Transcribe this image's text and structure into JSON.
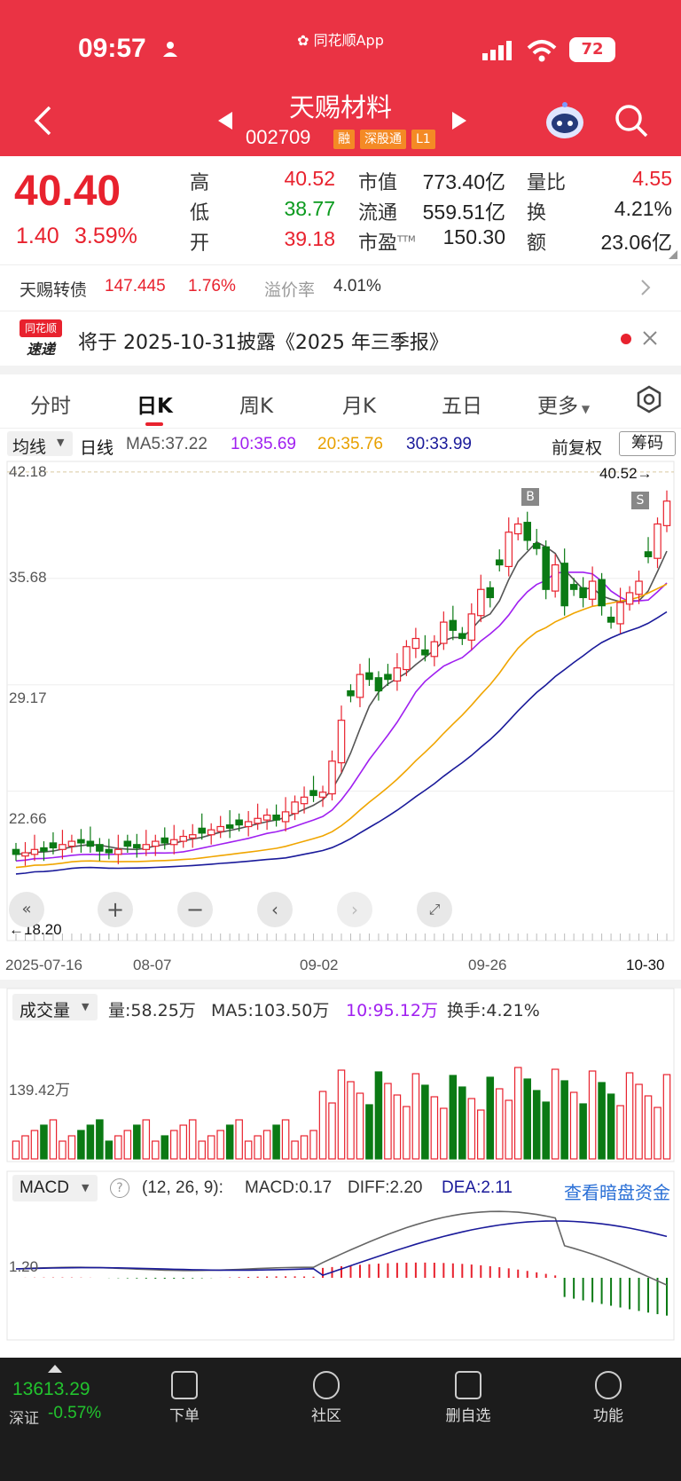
{
  "status_bar": {
    "time": "09:57",
    "app_name": "同花顺App",
    "battery": "72"
  },
  "header": {
    "title": "天赐材料",
    "code": "002709",
    "tags": [
      "融",
      "深股通",
      "L1"
    ]
  },
  "quote": {
    "price": "40.40",
    "change": "1.40",
    "change_pct": "3.59%",
    "high_label": "高",
    "high": "40.52",
    "low_label": "低",
    "low": "38.77",
    "open_label": "开",
    "open": "39.18",
    "mcap_label": "市值",
    "mcap": "773.40亿",
    "float_label": "流通",
    "float": "559.51亿",
    "pe_label": "市盈",
    "pe_sup": "TTM",
    "pe": "150.30",
    "vr_label": "量比",
    "vr": "4.55",
    "turnover_label": "换",
    "turnover": "4.21%",
    "amount_label": "额",
    "amount": "23.06亿"
  },
  "bond": {
    "name": "天赐转债",
    "price": "147.445",
    "pct": "1.76%",
    "premium_label": "溢价率",
    "premium": "4.01%"
  },
  "notice": {
    "logo_top": "同花顺",
    "logo_bottom": "速递",
    "text": "将于 2025-10-31披露《2025 年三季报》"
  },
  "tabs": [
    "分时",
    "日K",
    "周K",
    "月K",
    "五日",
    "更多"
  ],
  "kline": {
    "indicator": "均线",
    "period": "日线",
    "ma5": "MA5:37.22",
    "ma10": "10:35.69",
    "ma20": "20:35.76",
    "ma30": "30:33.99",
    "adjust": "前复权",
    "chip": "筹码",
    "y_labels": [
      "42.18",
      "35.68",
      "29.17",
      "22.66"
    ],
    "high_mark": "40.52→",
    "low_mark": "←18.20",
    "x_labels": [
      "2025-07-16",
      "08-07",
      "09-02",
      "09-26",
      "10-30"
    ],
    "marker_b": "B",
    "marker_s": "S"
  },
  "volume": {
    "indicator": "成交量",
    "vol": "量:58.25万",
    "ma5": "MA5:103.50万",
    "ma10": "10:95.12万",
    "turnover": "换手:4.21%",
    "y_label": "139.42万"
  },
  "macd": {
    "indicator": "MACD",
    "params": "(12, 26, 9):",
    "macd": "MACD:0.17",
    "diff": "DIFF:2.20",
    "dea": "DEA:2.11",
    "link": "查看暗盘资金",
    "y_label": "1.20"
  },
  "bottom": {
    "index_value": "13613.29",
    "index_name": "深证",
    "index_pct": "-0.57%",
    "nav": [
      "下单",
      "社区",
      "删自选",
      "功能"
    ]
  },
  "colors": {
    "up": "#e8222e",
    "down": "#0b7a14",
    "header": "#ea3344",
    "ma5": "#555555",
    "ma10": "#a020f0",
    "ma20": "#f0a500",
    "ma30": "#1a1a9a"
  },
  "chart_data": {
    "type": "candlestick",
    "x": [
      "2025-07-16",
      "08-07",
      "09-02",
      "09-26",
      "10-30"
    ],
    "close": [
      18.8,
      18.9,
      19.1,
      19.0,
      19.2,
      19.4,
      19.6,
      19.5,
      19.3,
      19.0,
      18.9,
      19.1,
      19.3,
      19.2,
      19.4,
      19.6,
      19.5,
      19.7,
      19.9,
      20.0,
      20.1,
      20.3,
      20.5,
      20.4,
      20.6,
      20.8,
      21.0,
      21.2,
      20.9,
      21.4,
      22.0,
      22.3,
      22.4,
      22.6,
      24.5,
      27.0,
      28.5,
      29.8,
      29.5,
      28.8,
      29.5,
      30.2,
      31.5,
      32.0,
      31.0,
      31.8,
      33.0,
      32.5,
      32.0,
      33.5,
      35.0,
      34.5,
      36.5,
      38.5,
      39.0,
      38.0,
      37.5,
      35.0,
      36.5,
      34.0,
      35.0,
      34.5,
      35.5,
      34.0,
      33.0,
      34.2,
      34.8,
      35.5,
      37.0,
      39.0,
      40.4
    ],
    "ma5_last": 37.22,
    "ma10_last": 35.69,
    "ma20_last": 35.76,
    "ma30_last": 33.99,
    "ylim": [
      17.0,
      42.5
    ]
  }
}
